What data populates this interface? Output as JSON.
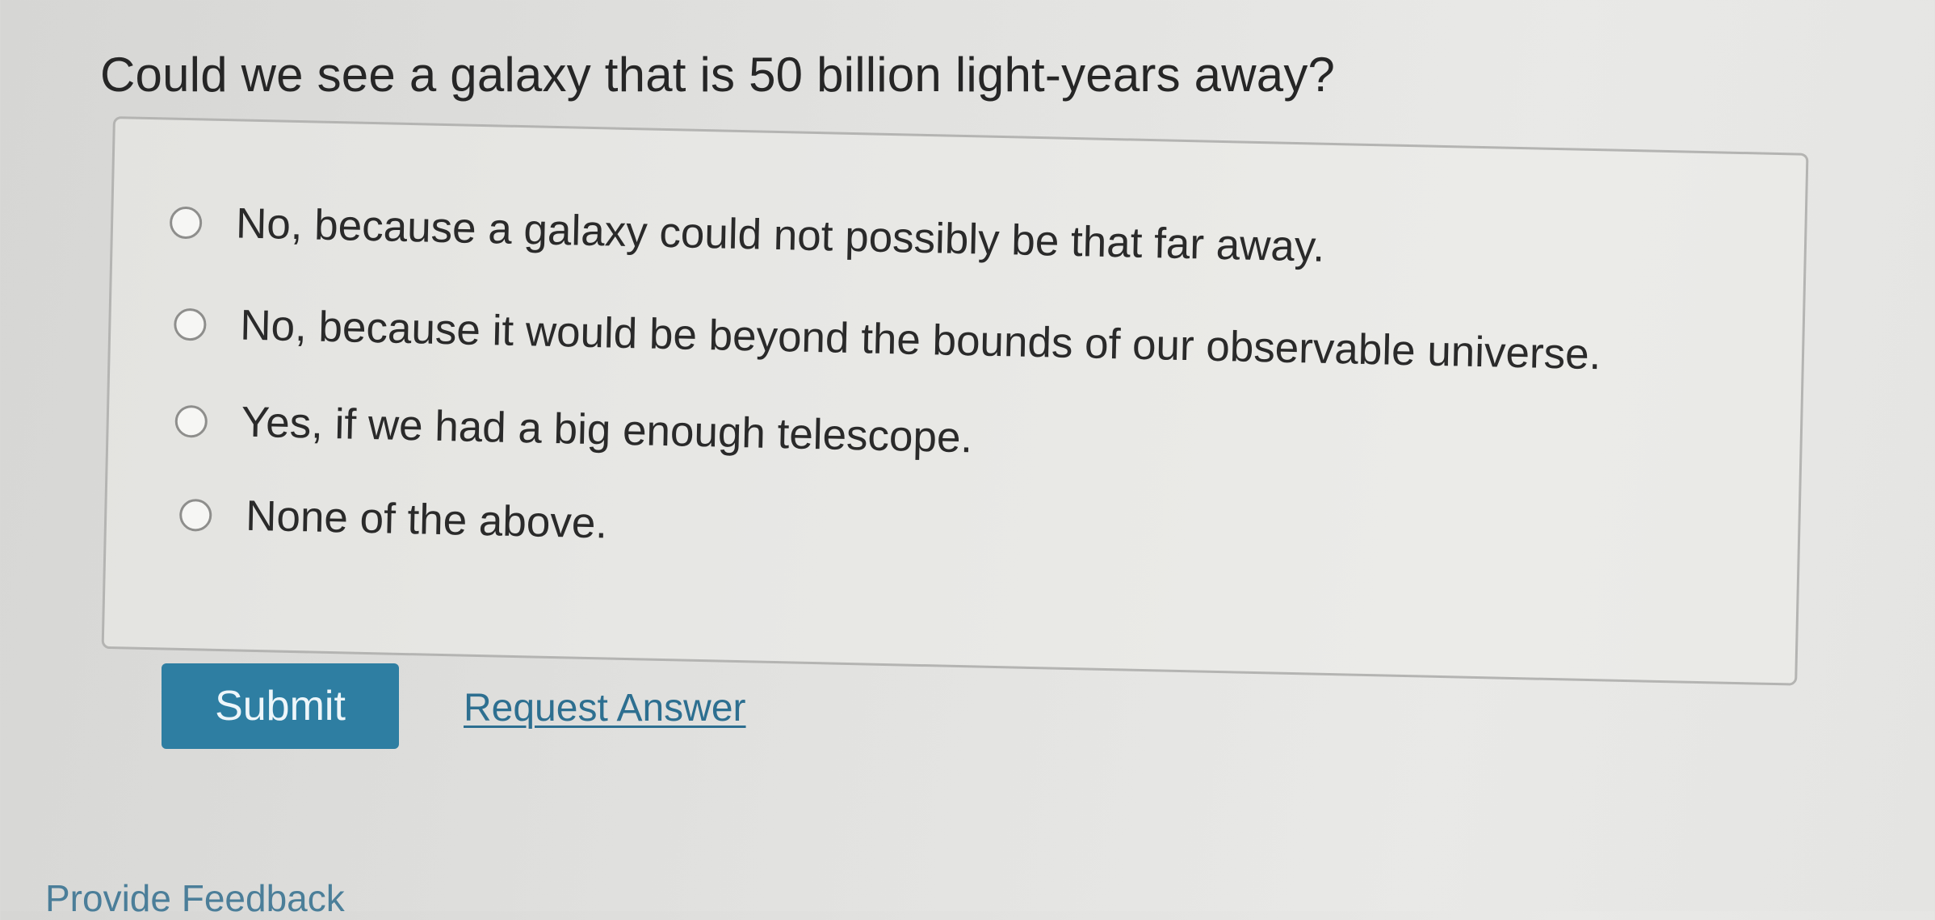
{
  "question": {
    "text": "Could we see a galaxy that is 50 billion light-years away?"
  },
  "options": [
    {
      "label": "No, because a galaxy could not possibly be that far away.",
      "selected": false
    },
    {
      "label": "No, because it would be beyond the bounds of our observable universe.",
      "selected": false
    },
    {
      "label": "Yes, if we had a big enough telescope.",
      "selected": false
    },
    {
      "label": "None of the above.",
      "selected": false
    }
  ],
  "actions": {
    "submit_label": "Submit",
    "request_answer_label": "Request Answer"
  },
  "footer": {
    "feedback_label": "Provide Feedback"
  },
  "colors": {
    "submit_background": "#2e7ea2",
    "link": "#2d6f90"
  }
}
